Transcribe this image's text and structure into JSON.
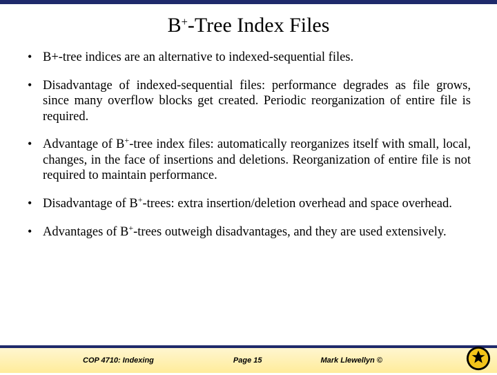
{
  "title": {
    "pre": "B",
    "sup": "+",
    "post": "-Tree Index Files"
  },
  "bullets": [
    "B+-tree indices are an alternative to indexed-sequential files.",
    "Disadvantage of indexed-sequential files: performance degrades as file grows, since many overflow blocks get created.  Periodic reorganization of entire file is required.",
    {
      "pre": "Advantage of B",
      "sup": "+",
      "post": "-tree index files:  automatically reorganizes itself with small, local, changes, in the face of insertions and deletions.  Reorganization of entire file is not required to maintain performance."
    },
    {
      "pre": "Disadvantage of B",
      "sup": "+",
      "post": "-trees: extra insertion/deletion overhead and space overhead."
    },
    {
      "pre": "Advantages of B",
      "sup": "+",
      "post": "-trees outweigh disadvantages, and they are used extensively."
    }
  ],
  "footer": {
    "course": "COP 4710: Indexing",
    "page": "Page 15",
    "author": "Mark Llewellyn ©"
  }
}
